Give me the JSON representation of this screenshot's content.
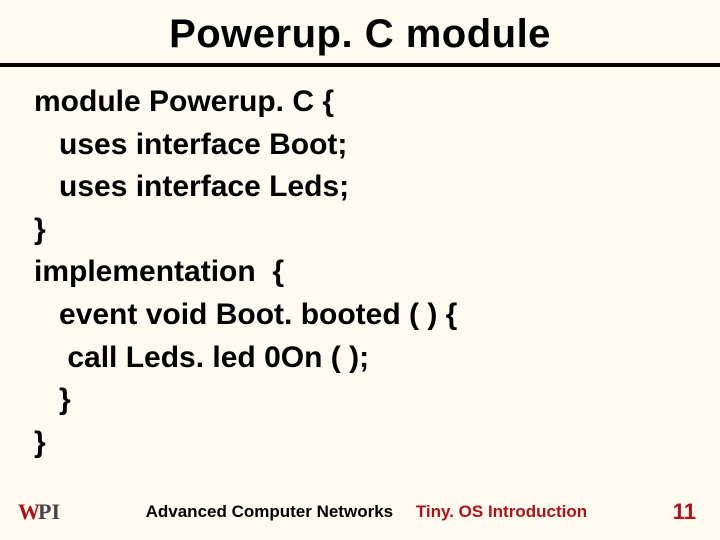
{
  "title": "Powerup. C module",
  "code": {
    "l1": "module Powerup. C {",
    "l2": "   uses interface Boot;",
    "l3": "   uses interface Leds;",
    "l4": "}",
    "l5": "implementation  {",
    "l6": "   event void Boot. booted ( ) {",
    "l7": "    call Leds. led 0On ( );",
    "l8": "   }",
    "l9": "}"
  },
  "footer": {
    "logo_w": "W",
    "logo_pi": "PI",
    "left": "Advanced Computer Networks",
    "right": "Tiny. OS Introduction",
    "page": "11"
  }
}
